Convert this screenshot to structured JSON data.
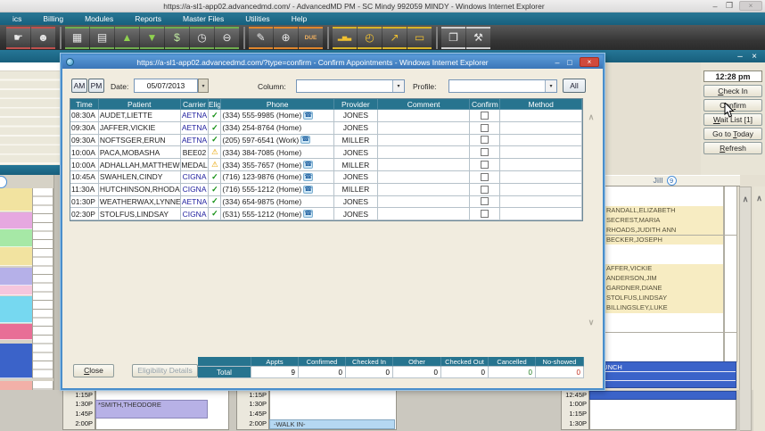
{
  "window": {
    "title": "https://a-sl1-app02.advancedmd.com/ - AdvancedMD PM - SC Mindy 992059 MINDY - Windows Internet Explorer",
    "controls": {
      "minimize": "–",
      "restore": "❐",
      "close": "×"
    },
    "menu": [
      "ics",
      "Billing",
      "Modules",
      "Reports",
      "Master Files",
      "Utilities",
      "Help"
    ]
  },
  "toolbar": {
    "icons": [
      {
        "name": "pointer-hand-icon",
        "glyph": "☛",
        "accent": "#c0504d",
        "group": 1
      },
      {
        "name": "patient-status-icon",
        "glyph": "☻",
        "accent": "#c0504d",
        "group": 1
      },
      {
        "name": "calculator-icon",
        "glyph": "▦",
        "accent": "#6fae4e",
        "group": 2
      },
      {
        "name": "scheduler-grid-icon",
        "glyph": "▤",
        "accent": "#6fae4e",
        "group": 2
      },
      {
        "name": "charge-up-icon",
        "glyph": "▲",
        "accent": "#6fae4e",
        "group": 2,
        "glyph_color": "#8fd14f"
      },
      {
        "name": "payment-down-icon",
        "glyph": "▼",
        "accent": "#6fae4e",
        "group": 2,
        "glyph_color": "#8fd14f"
      },
      {
        "name": "money-icon",
        "glyph": "$",
        "accent": "#6fae4e",
        "group": 2,
        "glyph_color": "#bfe8a0"
      },
      {
        "name": "time-clock-icon",
        "glyph": "◷",
        "accent": "#6fae4e",
        "group": 2
      },
      {
        "name": "zoom-out-icon",
        "glyph": "⊖",
        "accent": "#6fae4e",
        "group": 2
      },
      {
        "name": "charge-entry-icon",
        "glyph": "✎",
        "accent": "#e0862c",
        "group": 3
      },
      {
        "name": "claim-review-icon",
        "glyph": "⊕",
        "accent": "#e0862c",
        "group": 3
      },
      {
        "name": "due-stamp-icon",
        "glyph": "DUE",
        "accent": "#e0862c",
        "group": 3,
        "small": true,
        "glyph_color": "#f0b060"
      },
      {
        "name": "bar-chart-icon",
        "glyph": "▂▅▃",
        "accent": "#d9b427",
        "group": 4,
        "small": true,
        "glyph_color": "#f0c030"
      },
      {
        "name": "time-analysis-icon",
        "glyph": "◴",
        "accent": "#d9b427",
        "group": 4,
        "glyph_color": "#f0c030"
      },
      {
        "name": "trend-chart-icon",
        "glyph": "↗",
        "accent": "#d9b427",
        "group": 4,
        "glyph_color": "#f0c030"
      },
      {
        "name": "presentation-icon",
        "glyph": "▭",
        "accent": "#d9b427",
        "group": 4,
        "glyph_color": "#f0c030"
      },
      {
        "name": "documents-icon",
        "glyph": "❐",
        "accent": "#cfcfcf",
        "group": 5
      },
      {
        "name": "admin-tools-icon",
        "glyph": "⚒",
        "accent": "#cfcfcf",
        "group": 5
      }
    ]
  },
  "app_window": {
    "controls": {
      "minimize": "–",
      "close": "×"
    }
  },
  "dialog": {
    "title": "https://a-sl1-app02.advancedmd.com/?type=confirm - Confirm Appointments - Windows Internet Explorer",
    "controls": {
      "minimize": "–",
      "maximize": "□",
      "close": "×",
      "am": "AM",
      "pm": "PM",
      "date_label": "Date:",
      "date_value": "05/07/2013",
      "column_label": "Column:",
      "column_value": "",
      "profile_label": "Profile:",
      "profile_value": "",
      "all": "All"
    },
    "table": {
      "headers": [
        "Time",
        "Patient",
        "Carrier",
        "Elig",
        "Phone",
        "Provider",
        "Comment",
        "Confirm",
        "Method"
      ],
      "rows": [
        {
          "time": "08:30A",
          "patient": "AUDET,LIETTE",
          "carrier": "AETNA",
          "carrier_blue": true,
          "elig": "ok",
          "phone": "(334) 555-9985 (Home)",
          "phone_btn": true,
          "provider": "JONES",
          "comment": "",
          "confirmed": false,
          "method": ""
        },
        {
          "time": "09:30A",
          "patient": "JAFFER,VICKIE",
          "carrier": "AETNA",
          "carrier_blue": true,
          "elig": "ok",
          "phone": "(334) 254-8764 (Home)",
          "phone_btn": false,
          "provider": "JONES",
          "comment": "",
          "confirmed": false,
          "method": ""
        },
        {
          "time": "09:30A",
          "patient": "NOFTSGER,ERUN",
          "carrier": "AETNA",
          "carrier_blue": true,
          "elig": "ok",
          "phone": "(205) 597-6541 (Work)",
          "phone_btn": true,
          "provider": "MILLER",
          "comment": "",
          "confirmed": false,
          "method": ""
        },
        {
          "time": "10:00A",
          "patient": "PACA,MOBASHA",
          "carrier": "BEE02",
          "carrier_blue": false,
          "elig": "warn",
          "phone": "(334) 384-7085 (Home)",
          "phone_btn": false,
          "provider": "JONES",
          "comment": "",
          "confirmed": false,
          "method": ""
        },
        {
          "time": "10:00A",
          "patient": "ADHALLAH,MATTHEW",
          "carrier": "MEDAL",
          "carrier_blue": false,
          "elig": "warn",
          "phone": "(334) 355-7657 (Home)",
          "phone_btn": true,
          "provider": "MILLER",
          "comment": "",
          "confirmed": false,
          "method": ""
        },
        {
          "time": "10:45A",
          "patient": "SWAHLEN,CINDY",
          "carrier": "CIGNA",
          "carrier_blue": true,
          "elig": "ok",
          "phone": "(716) 123-9876 (Home)",
          "phone_btn": true,
          "provider": "JONES",
          "comment": "",
          "confirmed": false,
          "method": ""
        },
        {
          "time": "11:30A",
          "patient": "HUTCHINSON,RHODA",
          "carrier": "CIGNA",
          "carrier_blue": true,
          "elig": "ok",
          "phone": "(716) 555-1212 (Home)",
          "phone_btn": true,
          "provider": "MILLER",
          "comment": "",
          "confirmed": false,
          "method": ""
        },
        {
          "time": "01:30P",
          "patient": "WEATHERWAX,LYNNE",
          "carrier": "AETNA",
          "carrier_blue": true,
          "elig": "ok",
          "phone": "(334) 654-9875 (Home)",
          "phone_btn": false,
          "provider": "JONES",
          "comment": "",
          "confirmed": false,
          "method": ""
        },
        {
          "time": "02:30P",
          "patient": "STOLFUS,LINDSAY",
          "carrier": "CIGNA",
          "carrier_blue": true,
          "elig": "ok",
          "phone": "(531) 555-1212 (Home)",
          "phone_btn": true,
          "provider": "JONES",
          "comment": "",
          "confirmed": false,
          "method": ""
        }
      ],
      "elig_ok_glyph": "✓",
      "elig_warn_glyph": "⚠",
      "phone_glyph": "☎",
      "carrier_color": "#1f1f9e"
    },
    "footer": {
      "close_key": "C",
      "close_rest": "lose",
      "elig_details": "Eligibility Details",
      "totals": {
        "headers": [
          "Appts",
          "Confirmed",
          "Checked In",
          "Other",
          "Checked Out",
          "Cancelled",
          "No-showed"
        ],
        "row_label": "Total",
        "values": [
          "9",
          "0",
          "0",
          "0",
          "0",
          "0",
          "0"
        ],
        "value_colors": [
          "#000000",
          "#000000",
          "#000000",
          "#000000",
          "#000000",
          "#1c7a1c",
          "#c03020"
        ]
      }
    }
  },
  "right_panel": {
    "clock": "12:28 pm",
    "buttons": [
      {
        "name": "check-in-button",
        "pre": "",
        "key": "C",
        "post": "heck In"
      },
      {
        "name": "confirm-button",
        "pre": "Con",
        "key": "f",
        "post": "irm"
      },
      {
        "name": "wait-list-button",
        "pre": "",
        "key": "W",
        "post": "ait List [1]"
      },
      {
        "name": "go-to-today-button",
        "pre": "Go to ",
        "key": "T",
        "post": "oday"
      },
      {
        "name": "refresh-button",
        "pre": "",
        "key": "R",
        "post": "efresh"
      }
    ]
  },
  "schedule": {
    "provider_header": "Jill",
    "provider_count": "9",
    "list1": [
      "RANDALL,ELIZABETH",
      "SECREST,MARIA",
      "RHOADS,JUDITH ANN",
      "BECKER,JOSEPH"
    ],
    "list2": [
      "AFFER,VICKIE",
      "ANDERSON,JIM",
      "GARDNER,DIANE",
      "STOLFUS,LINDSAY",
      "BILLINGSLEY,LUKE"
    ],
    "lunch_label": "LUNCH",
    "left_times": [
      "1:15P",
      "1:30P",
      "1:45P",
      "2:00P"
    ],
    "mid_times": [
      "1:15P",
      "1:30P",
      "1:45P",
      "2:00P"
    ],
    "right_times": [
      "12:45P",
      "1:00P",
      "1:15P",
      "1:30P"
    ],
    "appointment_block": "*SMITH,THEODORE",
    "walk_in_block": "-WALK IN-",
    "left_block_colors": [
      "#f2e3a0",
      "#e6a8e0",
      "#a6e8a6",
      "#f2e3a0",
      "#b5b0e8",
      "#f5c6dd",
      "#76d8f0",
      "#e86e96",
      "#3b63c9",
      "#f2b0a8",
      "#f2b0a8",
      "#a6e8a6"
    ],
    "lunch_color": "#3b63c9"
  }
}
